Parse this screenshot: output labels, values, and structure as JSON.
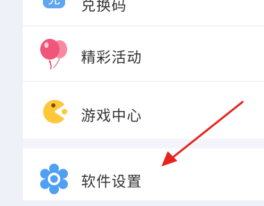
{
  "menu": {
    "items": [
      {
        "label": "兑换码",
        "icon": "exchange-code-icon"
      },
      {
        "label": "精彩活动",
        "icon": "balloon-icon"
      },
      {
        "label": "游戏中心",
        "icon": "pacman-icon"
      },
      {
        "label": "软件设置",
        "icon": "gear-icon"
      }
    ]
  },
  "colors": {
    "balloon": "#f0567a",
    "pacman": "#ffc83a",
    "gear": "#4f9ff5",
    "exchange": "#5fa6f0",
    "arrow": "#e8221d",
    "label": "#333333",
    "background": "#eef2f8"
  }
}
